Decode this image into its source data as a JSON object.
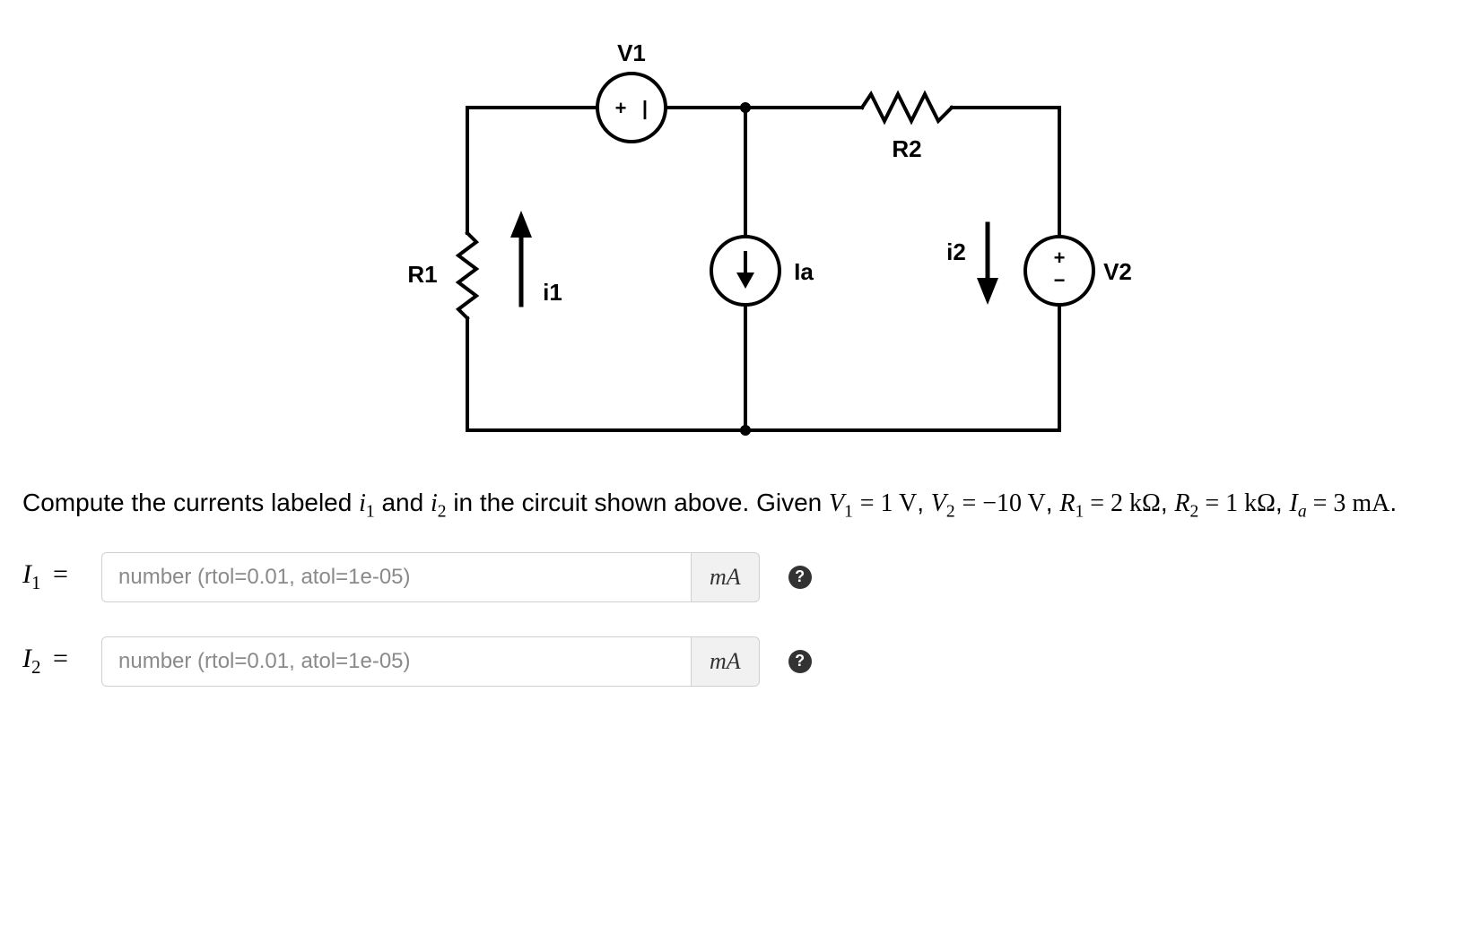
{
  "circuit": {
    "labels": {
      "V1": "V1",
      "V2": "V2",
      "R1": "R1",
      "R2": "R2",
      "i1": "i1",
      "i2": "i2",
      "Ia": "Ia"
    },
    "source_glyphs": {
      "plus": "+",
      "minus_bar": "|",
      "minus": "−"
    }
  },
  "question": {
    "prefix": "Compute the currents labeled ",
    "i1": "i",
    "i1_sub": "1",
    "mid1": " and ",
    "i2": "i",
    "i2_sub": "2",
    "mid2": " in the circuit shown above. Given ",
    "V1lhs": "V",
    "V1sub": "1",
    "eq": " = ",
    "V1val": "1 V",
    "comma1": ", ",
    "V2lhs": "V",
    "V2sub": "2",
    "V2val": "−10 V",
    "comma2": ", ",
    "R1lhs": "R",
    "R1sub": "1",
    "R1val": " = 2 kΩ",
    "comma3": ", ",
    "R2lhs": "R",
    "R2sub": "2",
    "R2val": " = 1 kΩ",
    "comma4": ", ",
    "Ialhs": "I",
    "Iasub": "a",
    "Iaval": " = 3 mA",
    "period": "."
  },
  "answers": {
    "placeholder": "number (rtol=0.01, atol=1e-05)",
    "unit": "mA",
    "I1_label_var": "I",
    "I1_label_sub": "1",
    "I2_label_var": "I",
    "I2_label_sub": "2",
    "eq": "=",
    "help": "?"
  }
}
